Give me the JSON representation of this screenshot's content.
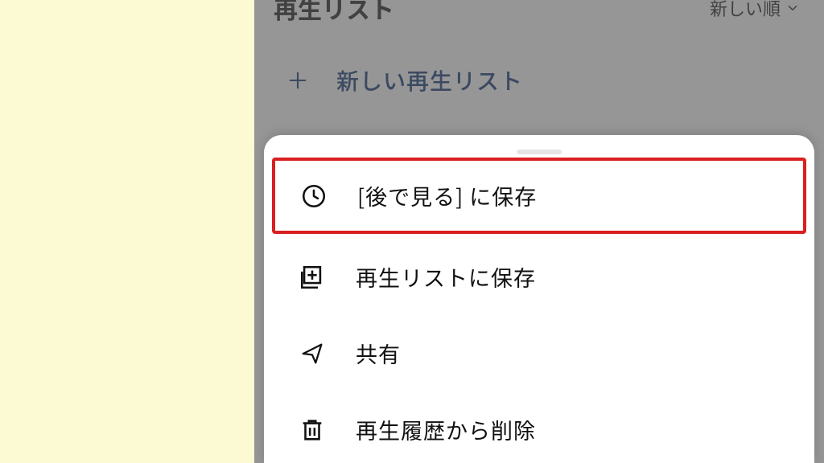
{
  "header": {
    "title": "再生リスト",
    "sort_label": "新しい順"
  },
  "new_playlist": {
    "label": "新しい再生リスト"
  },
  "sheet": {
    "items": [
      {
        "label": "[後で見る] に保存",
        "highlight": true
      },
      {
        "label": "再生リストに保存"
      },
      {
        "label": "共有"
      },
      {
        "label": "再生履歴から削除"
      }
    ]
  },
  "colors": {
    "accent_navy": "#0a2f6e",
    "highlight_red": "#d9201f",
    "page_bg": "#fcfad2"
  }
}
